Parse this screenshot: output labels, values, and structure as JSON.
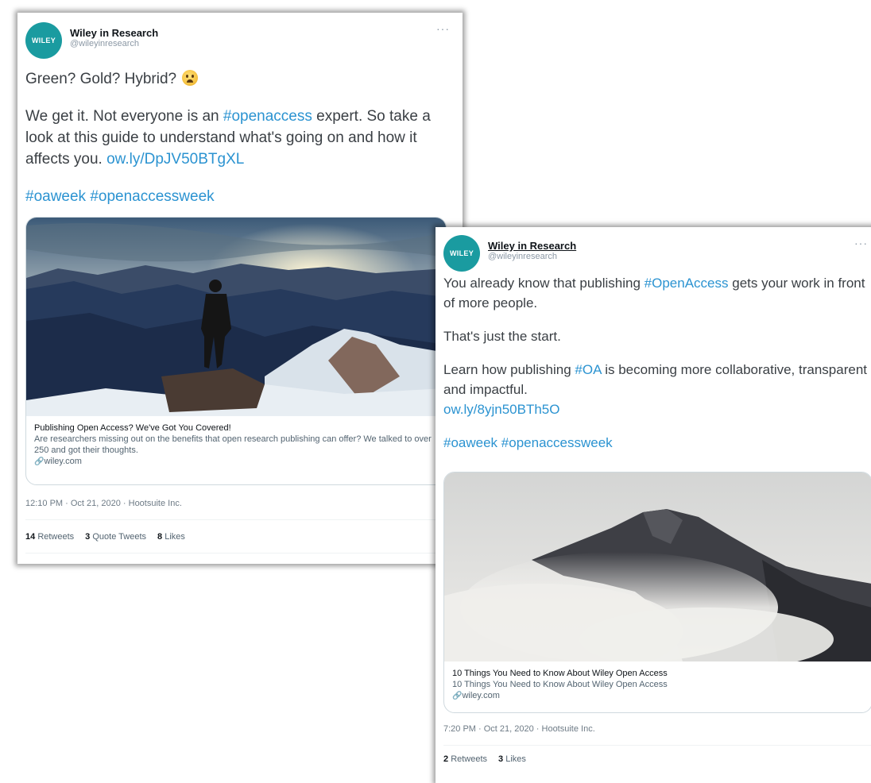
{
  "tweets": [
    {
      "author": {
        "name": "Wiley in Research",
        "handle": "@wileyinresearch",
        "avatar_text": "WILEY"
      },
      "more_icon": "more-horizontal-icon",
      "text": {
        "line1": "Green? Gold? Hybrid?",
        "p2_a": "We get it. Not everyone is an ",
        "p2_tag": "#openaccess",
        "p2_b": " expert. So take a look at this guide to understand what's going on and how it affects you. ",
        "p2_link": "ow.ly/DpJV50BTgXL",
        "tag1": "#oaweek",
        "tag2": "#openaccessweek"
      },
      "card": {
        "title": "Publishing Open Access? We've Got You Covered!",
        "description": "Are researchers missing out on the benefits that open research publishing can offer? We talked to over 250 and got their thoughts.",
        "domain": "wiley.com"
      },
      "timestamp": "12:10 PM · Oct 21, 2020 · Hootsuite Inc.",
      "stats": {
        "retweets_count": "14",
        "retweets_label": "Retweets",
        "quotes_count": "3",
        "quotes_label": "Quote Tweets",
        "likes_count": "8",
        "likes_label": "Likes"
      }
    },
    {
      "author": {
        "name": "Wiley in Research",
        "handle": "@wileyinresearch",
        "avatar_text": "WILEY"
      },
      "more_icon": "more-horizontal-icon",
      "text": {
        "p1_a": "You already know that publishing ",
        "p1_tag": "#OpenAccess",
        "p1_b": " gets your work in front of more people.",
        "p2": "That's just the start.",
        "p3_a": "Learn how publishing ",
        "p3_tag": "#OA",
        "p3_b": " is becoming more collaborative, transparent and impactful.",
        "p3_link": "ow.ly/8yjn50BTh5O",
        "tag1": "#oaweek",
        "tag2": "#openaccessweek"
      },
      "card": {
        "title": "10 Things You Need to Know About Wiley Open Access",
        "description": "10 Things You Need to Know About Wiley Open Access",
        "domain": "wiley.com"
      },
      "timestamp": "7:20 PM · Oct 21, 2020 · Hootsuite Inc.",
      "stats": {
        "retweets_count": "2",
        "retweets_label": "Retweets",
        "likes_count": "3",
        "likes_label": "Likes"
      }
    }
  ],
  "colors": {
    "link": "#2b93d1",
    "avatar": "#1a9ba0"
  }
}
